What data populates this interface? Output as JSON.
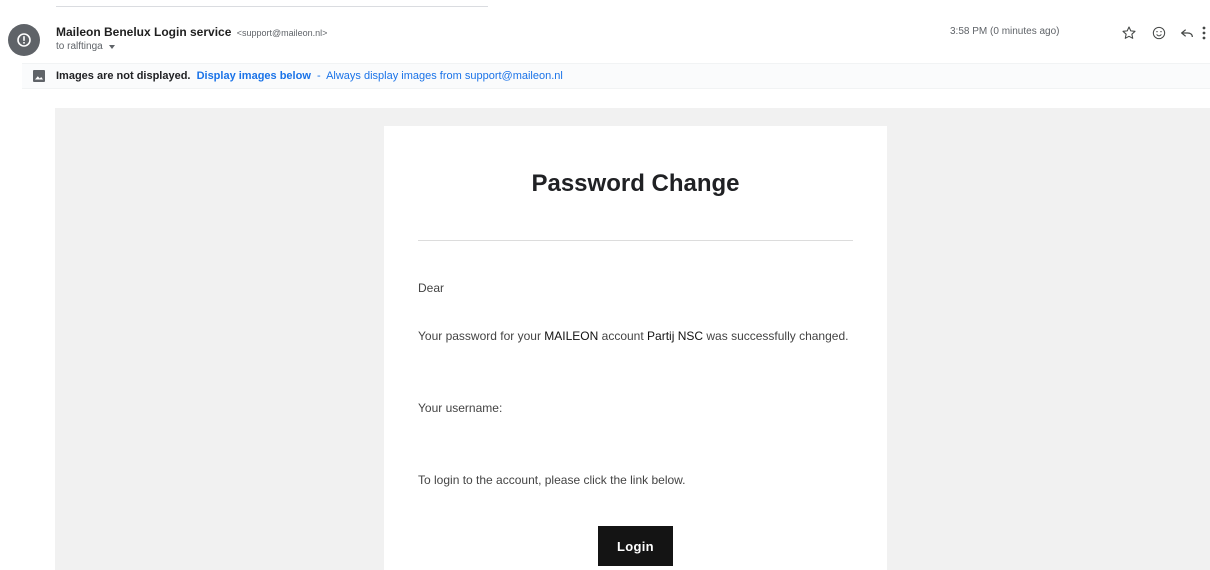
{
  "header": {
    "sender_name": "Maileon Benelux Login service",
    "sender_email": "<support@maileon.nl>",
    "to_text": "to ralftinga",
    "timestamp": "3:58 PM (0 minutes ago)",
    "icons": [
      "star-icon",
      "emoji-icon",
      "reply-icon",
      "more-options-icon"
    ]
  },
  "images_bar": {
    "message": "Images are not displayed.",
    "display_link": "Display images below",
    "separator": "-",
    "always_link": "Always display images from support@maileon.nl"
  },
  "email": {
    "title": "Password Change",
    "greeting": "Dear",
    "body_prefix": "Your password for your",
    "body_brand": "MAILEON",
    "body_middle": "account",
    "body_account": "Partij NSC",
    "body_suffix": "was successfully changed.",
    "username_label": "Your username:",
    "login_instruction": "To login to the account, please click the link below.",
    "login_button": "Login"
  },
  "colors": {
    "link": "#1a73e8",
    "avatar": "#5f6368",
    "button": "#141414",
    "email_background": "#f1f1f1"
  }
}
